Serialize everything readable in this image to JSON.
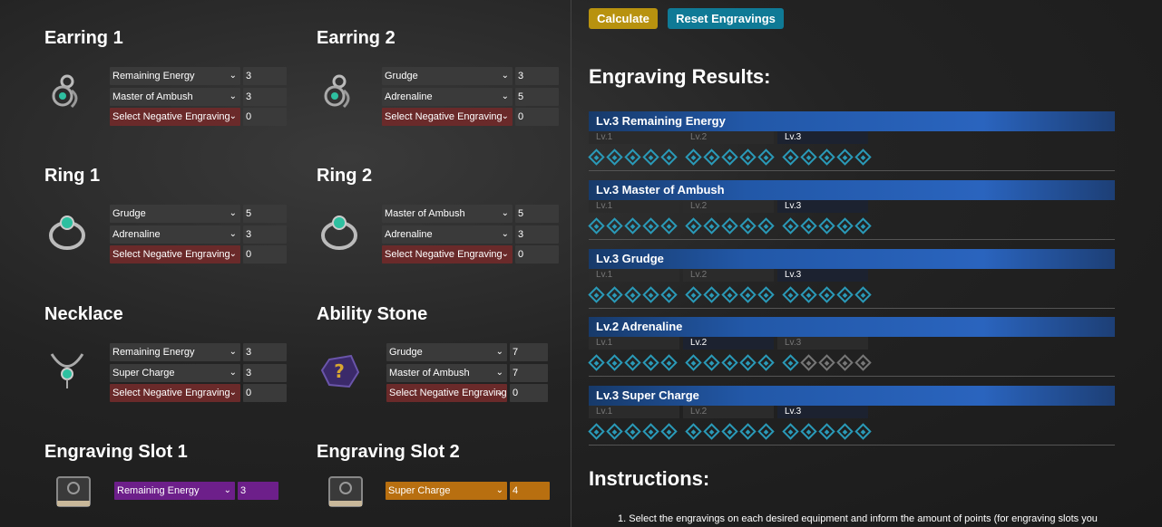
{
  "slots": {
    "earring1": {
      "title": "Earring 1",
      "rows": [
        {
          "name": "Remaining Energy",
          "value": "3"
        },
        {
          "name": "Master of Ambush",
          "value": "3"
        },
        {
          "name": "Select Negative Engraving",
          "value": "0"
        }
      ]
    },
    "earring2": {
      "title": "Earring 2",
      "rows": [
        {
          "name": "Grudge",
          "value": "3"
        },
        {
          "name": "Adrenaline",
          "value": "5"
        },
        {
          "name": "Select Negative Engraving",
          "value": "0"
        }
      ]
    },
    "ring1": {
      "title": "Ring 1",
      "rows": [
        {
          "name": "Grudge",
          "value": "5"
        },
        {
          "name": "Adrenaline",
          "value": "3"
        },
        {
          "name": "Select Negative Engraving",
          "value": "0"
        }
      ]
    },
    "ring2": {
      "title": "Ring 2",
      "rows": [
        {
          "name": "Master of Ambush",
          "value": "5"
        },
        {
          "name": "Adrenaline",
          "value": "3"
        },
        {
          "name": "Select Negative Engraving",
          "value": "0"
        }
      ]
    },
    "necklace": {
      "title": "Necklace",
      "rows": [
        {
          "name": "Remaining Energy",
          "value": "3"
        },
        {
          "name": "Super Charge",
          "value": "3"
        },
        {
          "name": "Select Negative Engraving",
          "value": "0"
        }
      ]
    },
    "stone": {
      "title": "Ability Stone",
      "rows": [
        {
          "name": "Grudge",
          "value": "7"
        },
        {
          "name": "Master of Ambush",
          "value": "7"
        },
        {
          "name": "Select Negative Engraving",
          "value": "0"
        }
      ]
    },
    "eslot1": {
      "title": "Engraving Slot 1",
      "rows": [
        {
          "name": "Remaining Energy",
          "value": "3"
        }
      ]
    },
    "eslot2": {
      "title": "Engraving Slot 2",
      "rows": [
        {
          "name": "Super Charge",
          "value": "4"
        }
      ]
    }
  },
  "buttons": {
    "calculate": "Calculate",
    "reset": "Reset Engravings"
  },
  "results_title": "Engraving Results:",
  "level_labels": [
    "Lv.1",
    "Lv.2",
    "Lv.3"
  ],
  "results": [
    {
      "label": "Lv.3 Remaining Energy",
      "level": 3,
      "filled_nodes": 15
    },
    {
      "label": "Lv.3 Master of Ambush",
      "level": 3,
      "filled_nodes": 15
    },
    {
      "label": "Lv.3 Grudge",
      "level": 3,
      "filled_nodes": 15
    },
    {
      "label": "Lv.2 Adrenaline",
      "level": 2,
      "filled_nodes": 11
    },
    {
      "label": "Lv.3 Super Charge",
      "level": 3,
      "filled_nodes": 15
    }
  ],
  "instructions_title": "Instructions:",
  "instructions_line1": "1. Select the engravings on each desired equipment and inform the amount of points (for engraving slots you",
  "colors": {
    "accent_blue": "#2a9ab8",
    "calculate": "#b8920f",
    "reset": "#0f7a96",
    "negative": "#6a2a2a",
    "slot1": "#6d1f8a",
    "slot2": "#b86f10"
  },
  "icons": {
    "earring": "earring-icon",
    "ring": "ring-icon",
    "necklace": "necklace-icon",
    "stone": "ability-stone-icon",
    "book": "engraving-book-icon"
  }
}
